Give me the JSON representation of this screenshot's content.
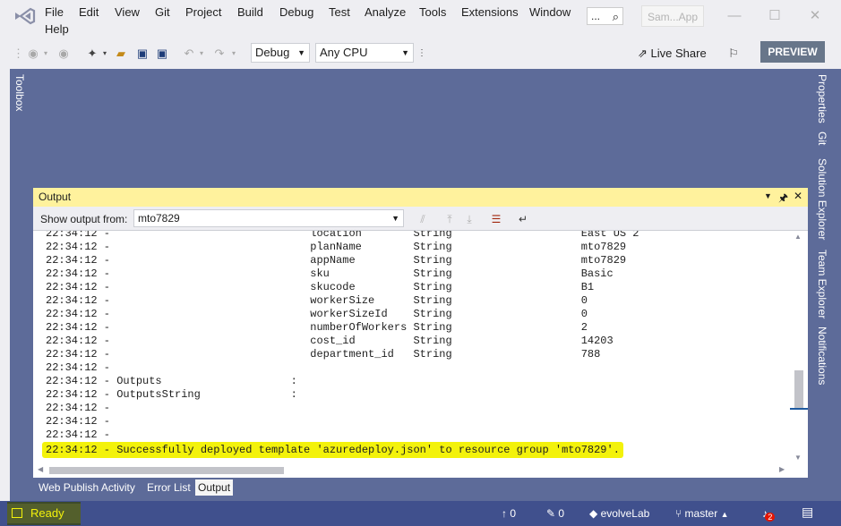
{
  "menu": {
    "items": [
      "File",
      "Edit",
      "View",
      "Git",
      "Project",
      "Build",
      "Debug",
      "Test",
      "Analyze",
      "Tools",
      "Extensions",
      "Window",
      "Help"
    ],
    "search_text": "...",
    "solution_badge": "Sam...App"
  },
  "toolbar": {
    "configuration": "Debug",
    "platform": "Any CPU",
    "live_share_label": "Live Share",
    "preview_label": "PREVIEW"
  },
  "side_tabs": {
    "left": [
      "Toolbox"
    ],
    "right": [
      "Properties",
      "Git",
      "Solution Explorer",
      "Team Explorer",
      "Notifications"
    ]
  },
  "output_window": {
    "title": "Output",
    "show_output_from_label": "Show output from:",
    "source": "mto7829",
    "lines": [
      "22:34:12 -                               location        String                    East US 2",
      "22:34:12 -                               planName        String                    mto7829",
      "22:34:12 -                               appName         String                    mto7829",
      "22:34:12 -                               sku             String                    Basic",
      "22:34:12 -                               skucode         String                    B1",
      "22:34:12 -                               workerSize      String                    0",
      "22:34:12 -                               workerSizeId    String                    0",
      "22:34:12 -                               numberOfWorkers String                    2",
      "22:34:12 -                               cost_id         String                    14203",
      "22:34:12 -                               department_id   String                    788",
      "22:34:12 -",
      "22:34:12 - Outputs                    :",
      "22:34:12 - OutputsString              :",
      "22:34:12 -",
      "22:34:12 -",
      "22:34:12 -",
      "22:34:12 - Successfully deployed template 'azuredeploy.json' to resource group 'mto7829'."
    ]
  },
  "bottom_tabs": [
    "Web Publish Activity",
    "Error List",
    "Output"
  ],
  "status_bar": {
    "ready": "Ready",
    "push_count": "0",
    "pending_changes": "0",
    "repo": "evolveLab",
    "branch": "master",
    "notification_count": "2"
  }
}
